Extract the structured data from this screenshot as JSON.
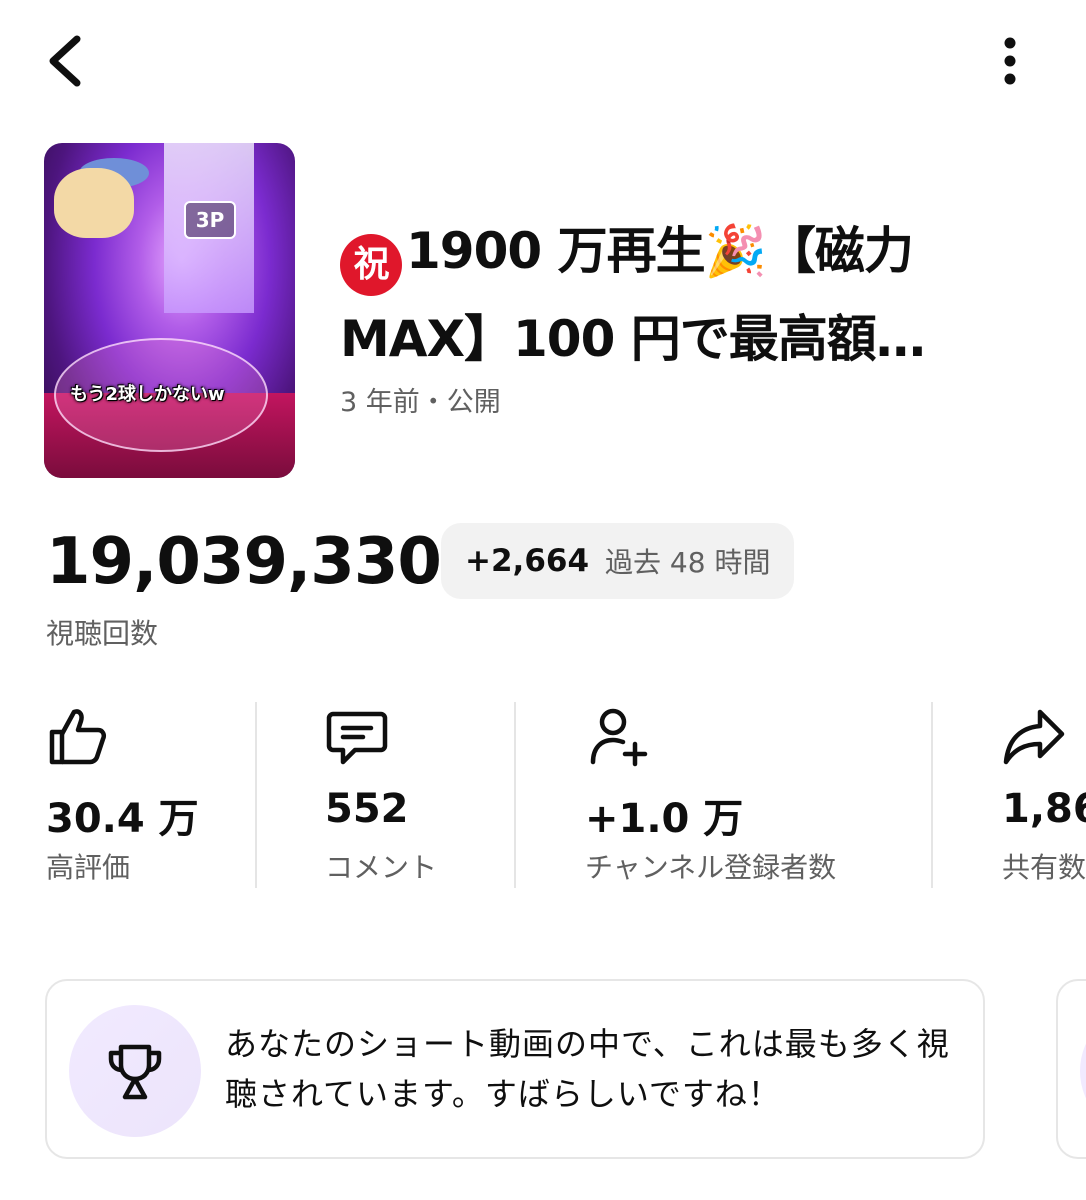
{
  "header": {
    "back_icon": "chevron-left-icon",
    "more_icon": "more-vertical-icon"
  },
  "thumbnail": {
    "overlay_text": "もう2球しかないw",
    "tag": "3P"
  },
  "video": {
    "title_mark": "祝",
    "title_line1": "1900 万再生🎉【磁力",
    "title_line2": "MAX】100 円で最高額…",
    "meta": "3 年前・公開"
  },
  "views": {
    "value": "19,039,330",
    "label": "視聴回数",
    "recent_value": "+2,664",
    "recent_period": "過去 48 時間"
  },
  "stats": [
    {
      "icon": "thumbs-up-icon",
      "value": "30.4 万",
      "label": "高評価"
    },
    {
      "icon": "comment-icon",
      "value": "552",
      "label": "コメント"
    },
    {
      "icon": "add-subscriber-icon",
      "value": "+1.0 万",
      "label": "チャンネル登録者数"
    },
    {
      "icon": "share-icon",
      "value": "1,86",
      "label": "共有数"
    }
  ],
  "insight": {
    "icon": "trophy-icon",
    "text": "あなたのショート動画の中で、これは最も多く視聴されています。すばらしいですね！"
  },
  "colors": {
    "accent_red": "#e0172b",
    "muted_text": "#606060",
    "chip_bg": "#f2f2f2",
    "trophy_bg": "#f1eaff"
  }
}
